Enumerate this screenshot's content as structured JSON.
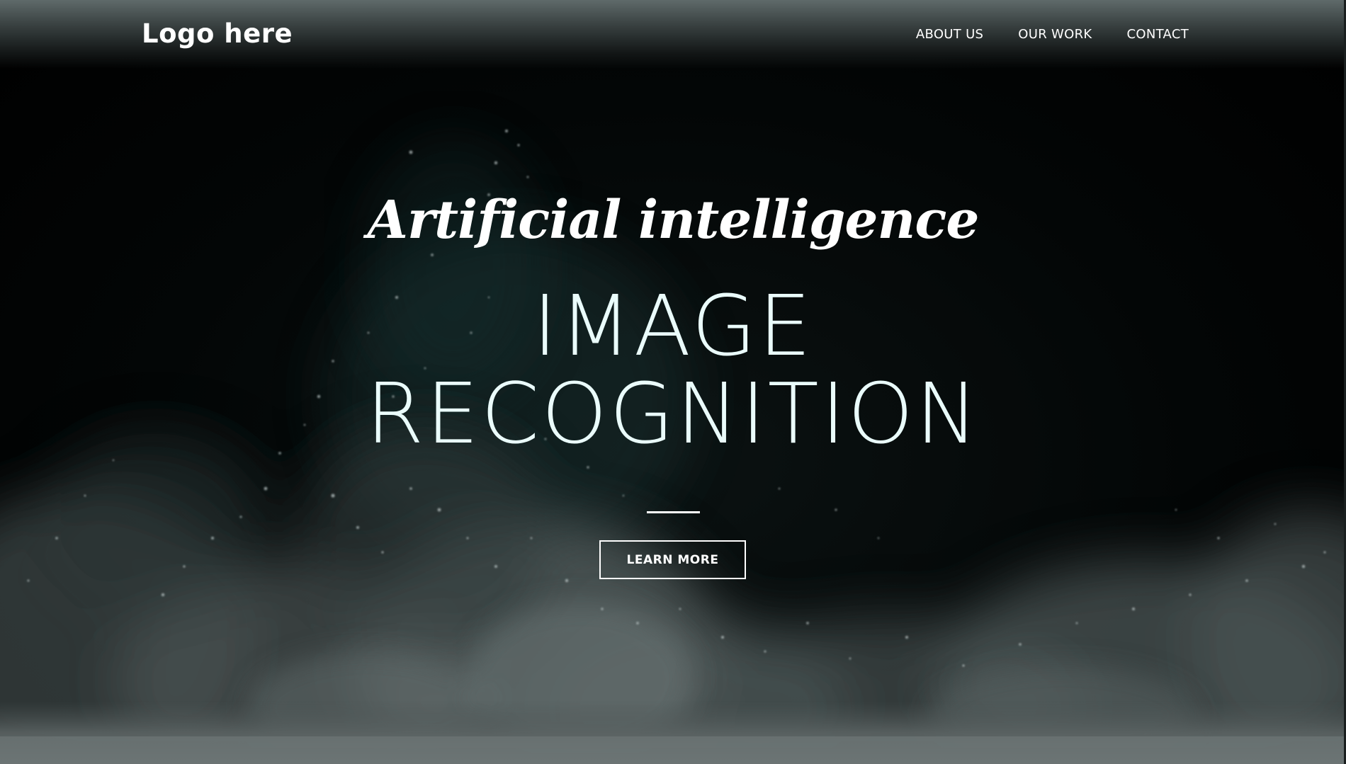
{
  "header": {
    "logo": "Logo here",
    "nav": [
      {
        "label": "ABOUT US"
      },
      {
        "label": "OUR WORK"
      },
      {
        "label": "CONTACT"
      }
    ]
  },
  "hero": {
    "tagline": "Artificial intelligence",
    "headline_line1": "IMAGE",
    "headline_line2": "RECOGNITION",
    "cta_label": "LEARN MORE"
  },
  "colors": {
    "background": "#000000",
    "headline": "#eafcfb",
    "header_top": "#5f6a6a",
    "dust": "#7f8a8a"
  }
}
